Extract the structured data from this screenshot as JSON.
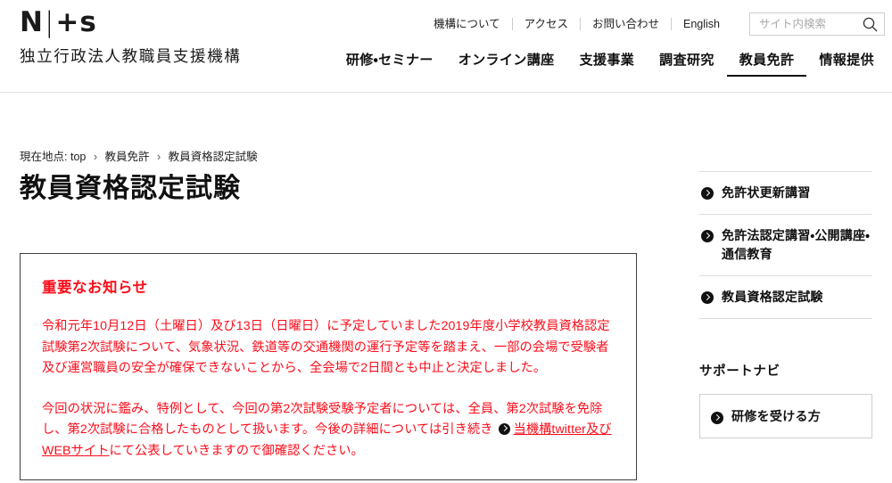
{
  "header": {
    "logo": {
      "mark_left": "N",
      "mark_bar": "|",
      "mark_right": "+s",
      "org_name": "独立行政法人教職員支援機構"
    },
    "utility_nav": [
      {
        "label": "機構について"
      },
      {
        "label": "アクセス"
      },
      {
        "label": "お問い合わせ"
      },
      {
        "label": "English"
      }
    ],
    "search": {
      "placeholder": "サイト内検索",
      "value": "",
      "icon": "search-icon"
    },
    "main_nav": [
      {
        "label": "研修・セミナー",
        "active": false
      },
      {
        "label": "オンライン講座",
        "active": false
      },
      {
        "label": "支援事業",
        "active": false
      },
      {
        "label": "調査研究",
        "active": false
      },
      {
        "label": "教員免許",
        "active": true
      },
      {
        "label": "情報提供",
        "active": false
      }
    ]
  },
  "breadcrumb": {
    "prefix": "現在地点:",
    "items": [
      {
        "label": "top"
      },
      {
        "label": "教員免許"
      },
      {
        "label": "教員資格認定試験"
      }
    ],
    "separator": "›"
  },
  "page": {
    "title": "教員資格認定試験"
  },
  "notice": {
    "title": "重要なお知らせ",
    "paragraph1": "令和元年10月12日（土曜日）及び13日（日曜日）に予定していました2019年度小学校教員資格認定試験第2次試験について、気象状況、鉄道等の交通機関の運行予定等を踏まえ、一部の会場で受験者及び運営職員の安全が確保できないことから、全会場で2日間とも中止と決定しました。",
    "paragraph2_before_link": "今回の状況に鑑み、特例として、今回の第2次試験受験予定者については、全員、第2次試験を免除し、第2次試験に合格したものとして扱います。今後の詳細については引き続き ",
    "paragraph2_link": "当機構twitter及びWEBサイト",
    "paragraph2_after_link": "にて公表していきますので御確認ください。",
    "link_icon": "circle-arrow-icon",
    "accent_color": "#fc0d1b"
  },
  "sidebar": {
    "items": [
      {
        "label": "免許状更新講習",
        "icon": "circle-arrow-icon"
      },
      {
        "label": "免許法認定講習・公開講座・通信教育",
        "icon": "circle-arrow-icon"
      },
      {
        "label": "教員資格認定試験",
        "icon": "circle-arrow-icon"
      }
    ],
    "support": {
      "title": "サポートナビ",
      "items": [
        {
          "label": "研修を受ける方",
          "icon": "circle-arrow-icon"
        }
      ]
    }
  }
}
